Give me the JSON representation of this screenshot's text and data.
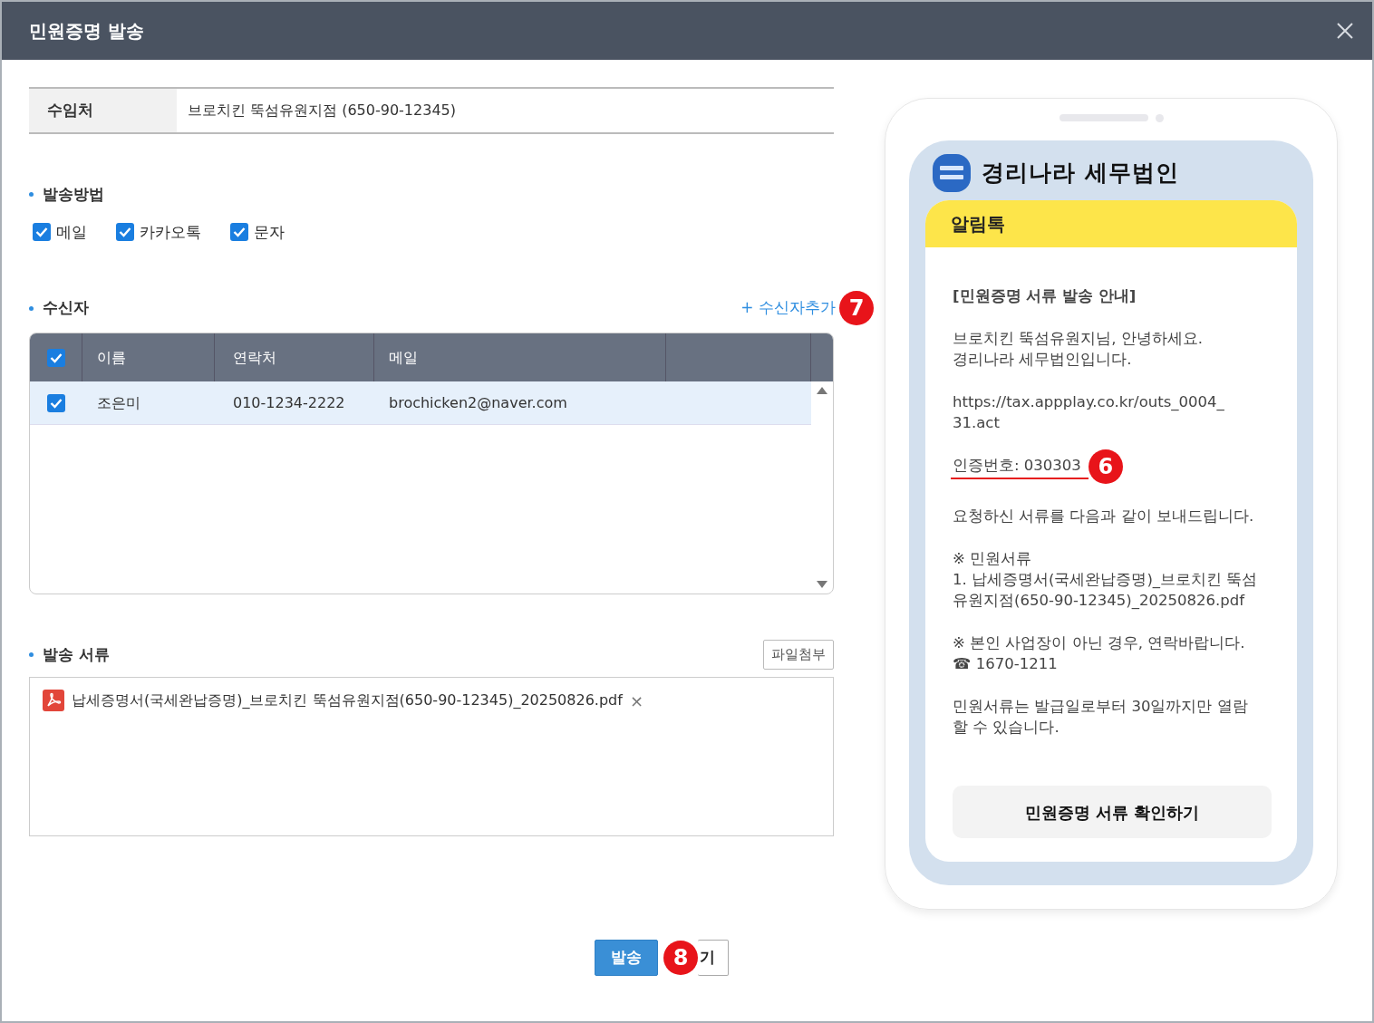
{
  "window": {
    "title": "민원증명 발송"
  },
  "recipient_org": {
    "label": "수임처",
    "value": "브로치킨 뚝섬유원지점 (650-90-12345)"
  },
  "send_method": {
    "title": "발송방법",
    "options": [
      {
        "label": "메일",
        "checked": true
      },
      {
        "label": "카카오톡",
        "checked": true
      },
      {
        "label": "문자",
        "checked": true
      }
    ]
  },
  "recipients": {
    "title": "수신자",
    "add_link": "+ 수신자추가",
    "callout": "7",
    "header_checked": true,
    "columns": [
      "이름",
      "연락처",
      "메일"
    ],
    "rows": [
      {
        "checked": true,
        "selected": true,
        "cells": [
          "조은미",
          "010-1234-2222",
          "brochicken2@naver.com"
        ]
      }
    ]
  },
  "documents": {
    "title": "발송 서류",
    "attach_button": "파일첨부",
    "files": [
      {
        "name": "납세증명서(국세완납증명)_브로치킨 뚝섬유원지점(650-90-12345)_20250826.pdf",
        "remove": "×"
      }
    ]
  },
  "preview": {
    "sender": "경리나라 세무법인",
    "banner": "알림톡",
    "paragraphs": [
      {
        "kind": "title",
        "lines": [
          "[민원증명 서류 발송 안내]"
        ]
      },
      {
        "kind": "text",
        "lines": [
          "브로치킨 뚝섬유원지님, 안녕하세요.",
          "경리나라 세무법인입니다."
        ]
      },
      {
        "kind": "text",
        "lines": [
          "https://tax.appplay.co.kr/outs_0004_",
          "31.act"
        ]
      },
      {
        "kind": "code",
        "lines": [
          "인증번호: 030303"
        ],
        "callout": "6"
      },
      {
        "kind": "text",
        "lines": [
          "요청하신 서류를 다음과 같이 보내드립니다."
        ]
      },
      {
        "kind": "text",
        "lines": [
          "※ 민원서류",
          "1. 납세증명서(국세완납증명)_브로치킨 뚝섬",
          "유원지점(650-90-12345)_20250826.pdf"
        ]
      },
      {
        "kind": "text",
        "lines": [
          "※ 본인 사업장이 아닌 경우, 연락바랍니다.",
          "☎ 1670-1211"
        ]
      },
      {
        "kind": "text",
        "lines": [
          "민원서류는 발급일로부터 30일까지만 열람",
          "할 수 있습니다."
        ]
      }
    ],
    "button": "민원증명 서류 확인하기"
  },
  "footer": {
    "callout": "8",
    "buttons": [
      {
        "label": "발송",
        "kind": "primary"
      },
      {
        "label": "기",
        "kind": "secondary"
      }
    ]
  }
}
